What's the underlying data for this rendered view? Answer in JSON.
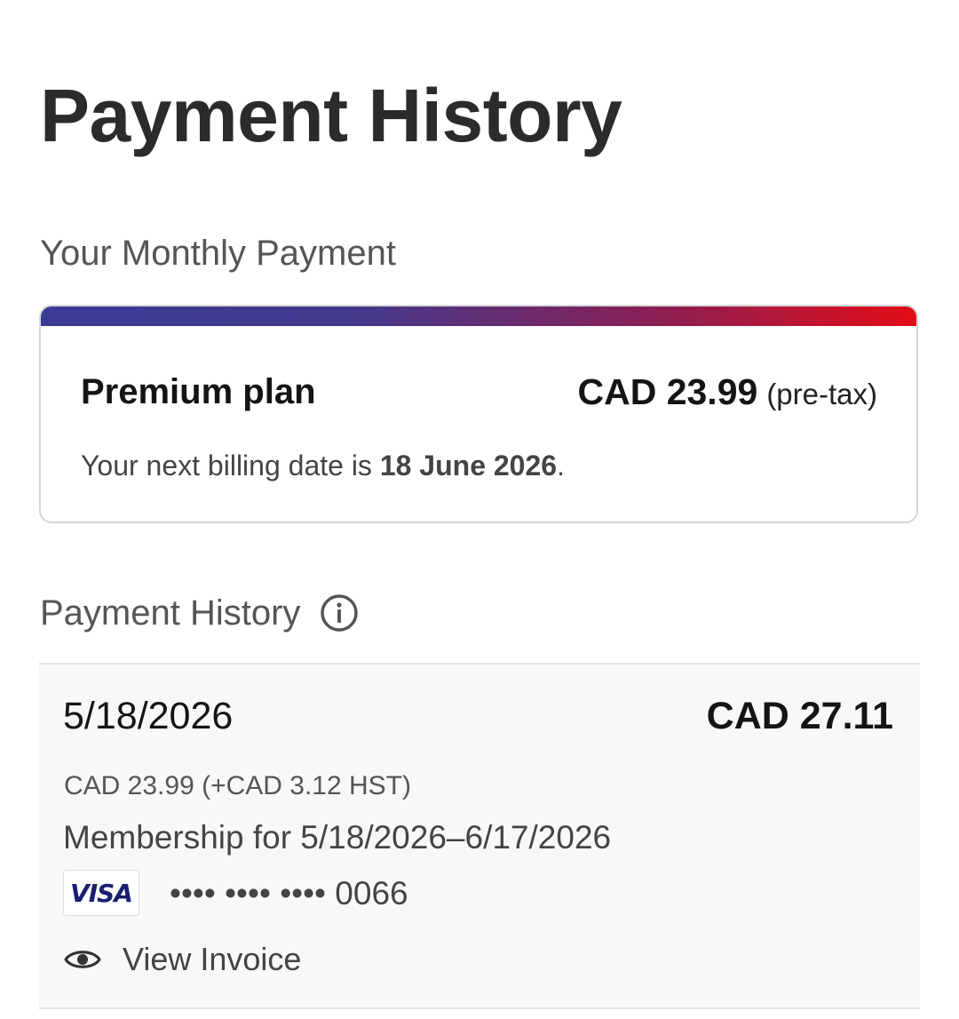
{
  "page": {
    "title": "Payment History"
  },
  "monthly": {
    "label": "Your Monthly Payment",
    "plan_name": "Premium plan",
    "price": "CAD 23.99",
    "price_note": "(pre-tax)",
    "billing_prefix": "Your next billing date is ",
    "billing_date": "18 June 2026",
    "billing_suffix": ".",
    "accent_gradient": [
      "#3b3c96",
      "#e20d17"
    ]
  },
  "history": {
    "label": "Payment History",
    "info_icon": "info-icon",
    "rows": [
      {
        "date": "5/18/2026",
        "total": "CAD 27.11",
        "breakdown": "CAD 23.99 (+CAD 3.12 HST)",
        "membership": "Membership for 5/18/2026–6/17/2026",
        "card_brand": "VISA",
        "card_number": "•••• •••• •••• 0066",
        "invoice_icon": "eye-icon",
        "invoice_label": "View Invoice"
      }
    ]
  }
}
